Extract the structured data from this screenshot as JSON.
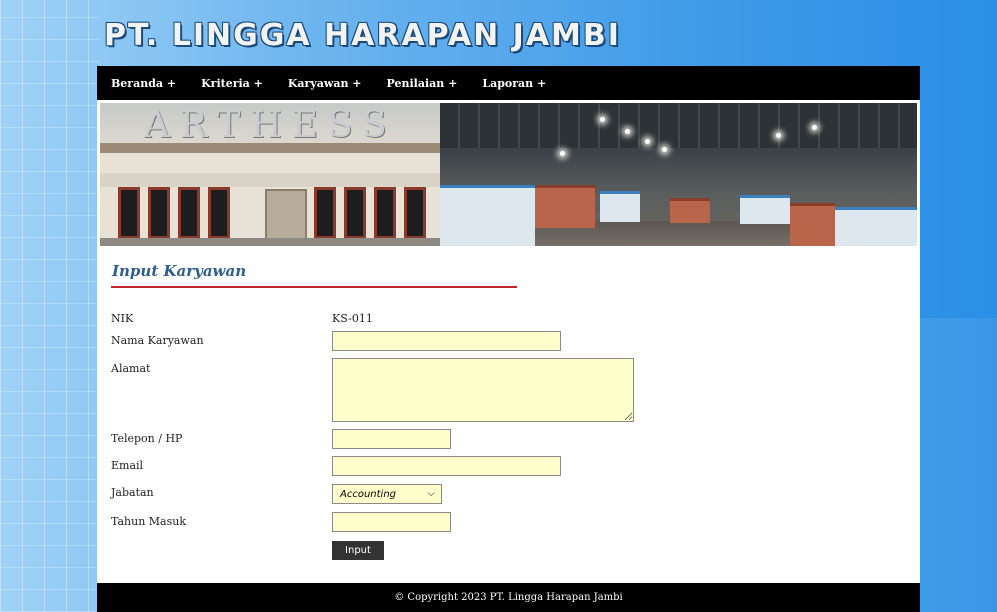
{
  "site": {
    "title": "PT. LINGGA HARAPAN JAMBI"
  },
  "nav": {
    "items": [
      {
        "label": "Beranda +"
      },
      {
        "label": "Kriteria +"
      },
      {
        "label": "Karyawan +"
      },
      {
        "label": "Penilaian +"
      },
      {
        "label": "Laporan +"
      }
    ]
  },
  "banner": {
    "sign_text": "ARTHESS"
  },
  "form": {
    "title": "Input Karyawan",
    "nik_label": "NIK",
    "nik_value": "KS-011",
    "nama_label": "Nama Karyawan",
    "nama_value": "",
    "alamat_label": "Alamat",
    "alamat_value": "",
    "telepon_label": "Telepon / HP",
    "telepon_value": "",
    "email_label": "Email",
    "email_value": "",
    "jabatan_label": "Jabatan",
    "jabatan_selected": "Accounting",
    "tahun_label": "Tahun Masuk",
    "tahun_value": "",
    "submit_label": "Input"
  },
  "footer": {
    "text": "© Copyright 2023 PT. Lingga Harapan Jambi"
  },
  "colors": {
    "accent_rule": "#c0262b",
    "title_blue": "#2e5e8e",
    "input_bg": "#ffffcc",
    "bar_black": "#000000"
  }
}
